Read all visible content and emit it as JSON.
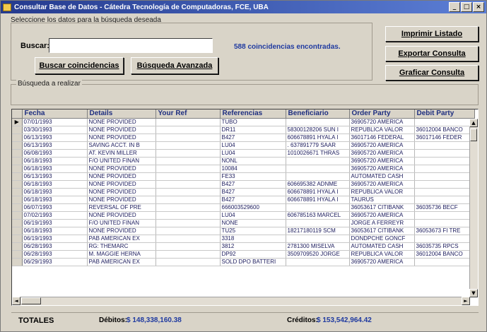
{
  "window": {
    "title": "Consultar Base de Datos - Cátedra Tecnología de Computadoras, FCE, UBA",
    "minimize": "_",
    "maximize": "□",
    "close": "×"
  },
  "search": {
    "instructions": "Seleccione los datos para la búsqueda deseada",
    "label": "Buscar:",
    "value": "",
    "results_text": "588 coincidencias encontradas.",
    "search_button": "Buscar coincidencias",
    "advanced_button": "Búsqueda Avanzada"
  },
  "actions": {
    "print": "Imprimir Listado",
    "export": "Exportar Consulta",
    "chart": "Graficar Consulta"
  },
  "analysis": {
    "label": "Búsqueda a realizar"
  },
  "grid": {
    "columns": [
      "Fecha",
      "Details",
      "Your Ref",
      "Referencias",
      "Beneficiario",
      "Order Party",
      "Debit Party"
    ],
    "rows": [
      [
        "07/01/1993",
        "NONE PROVIDED",
        "",
        "TUBO",
        "",
        "36905720 AMERICA",
        ""
      ],
      [
        "03/30/1993",
        "NONE PROVIDED",
        "",
        "DR11",
        "58300128206 SUN I",
        "REPUBLICA VALOR",
        "36012004 BANCO"
      ],
      [
        "06/13/1993",
        "NONE PROVIDED",
        "",
        "B427",
        "606678891 HYALA I",
        "36017146 FEDERAL",
        "36017146 FEDER"
      ],
      [
        "06/13/1993",
        "SAVING ACCT. IN B",
        "",
        "LU04",
        ". 637891779 SAAR",
        "36905720 AMERICA",
        ""
      ],
      [
        "06/08/1993",
        "AT. KEVIN MILLER",
        "",
        "LU04",
        "1010026671 THRAS",
        "36905720 AMERICA",
        ""
      ],
      [
        "06/18/1993",
        "F/O UNITED FINAN",
        "",
        "NONL",
        "",
        "36905720 AMERICA",
        ""
      ],
      [
        "06/18/1993",
        "NONE PROVIDED",
        "",
        "10084",
        "",
        "36905720 AMERICA",
        ""
      ],
      [
        "06/13/1993",
        "NONE PROVIDED",
        "",
        "FE33",
        "",
        "AUTOMATED CASH",
        ""
      ],
      [
        "06/18/1993",
        "NONE PROVIDED",
        "",
        "B427",
        "606695382 ADNME",
        "36905720 AMERICA",
        ""
      ],
      [
        "06/18/1993",
        "NONE PROVIDED",
        "",
        "B427",
        "606678891 HYALA I",
        "REPUBLICA VALOR",
        ""
      ],
      [
        "06/18/1993",
        "NONE PROVIDED",
        "",
        "B427",
        "606678891 HYALA I",
        "TAURUS",
        ""
      ],
      [
        "06/07/1993",
        "REVERSAL OF PRE",
        "",
        "666003529600",
        "",
        "36053617 CITIBANK",
        "36035736 BECF"
      ],
      [
        "07/02/1993",
        "NONE PROVIDED",
        "",
        "LU04",
        "606785163 MARCEL",
        "36905720 AMERICA",
        ""
      ],
      [
        "06/19/1993",
        "F/O UNITED FINAN",
        "",
        "NONE",
        "",
        "JORGE A FERREYR",
        ""
      ],
      [
        "06/18/1993",
        "NONE PROVIDED",
        "",
        "TU25",
        "18217180119 SCM",
        "36053617 CITIBANK",
        "36053673 FI TRE"
      ],
      [
        "06/19/1993",
        "PAB AMERICAN EX",
        "",
        "3318",
        "",
        "DONDPCHE GONCF",
        ""
      ],
      [
        "06/28/1993",
        "RG: THEMARC",
        "",
        "3812",
        "2781300 MISELVA",
        "AUTOMATED CASH",
        "36035735 RPCS"
      ],
      [
        "06/28/1993",
        "M. MAGGIE HERNA",
        "",
        "DP92",
        "3509709520 JORGE",
        "REPUBLICA VALOR",
        "36012004 BANCO"
      ],
      [
        "06/29/1993",
        "PAB AMERICAN EX",
        "",
        "SOLD DPO BATTERI",
        "",
        "36905720 AMERICA",
        ""
      ]
    ]
  },
  "totals": {
    "label": "TOTALES",
    "debits_label": "Débitos:",
    "debits_value": "$ 148,338,160.38",
    "credits_label": "Créditos:",
    "credits_value": "$ 153,542,964.42"
  },
  "colors": {
    "title_bar": "#243a8e",
    "accent_text": "#1f3aa0",
    "face": "#d9d4c8"
  }
}
